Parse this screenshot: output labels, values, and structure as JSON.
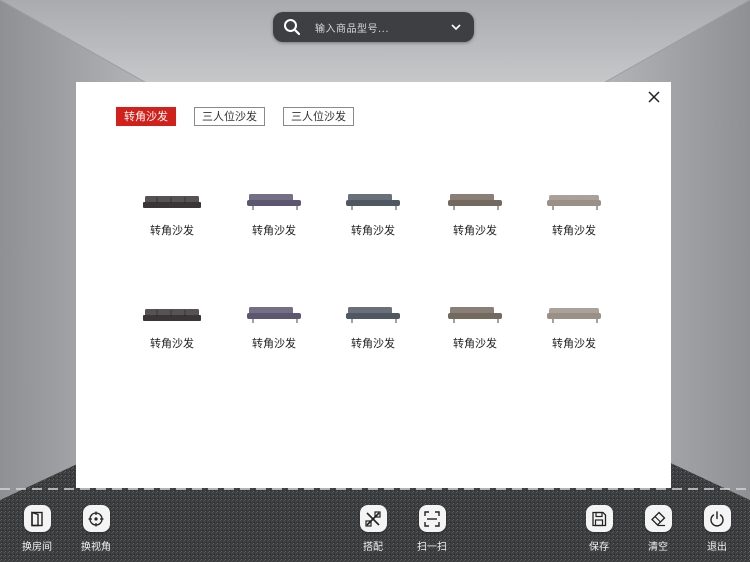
{
  "search": {
    "placeholder": "输入商品型号..."
  },
  "modal": {
    "tabs": [
      {
        "label": "转角沙发",
        "active": true
      },
      {
        "label": "三人位沙发",
        "active": false
      },
      {
        "label": "三人位沙发",
        "active": false
      }
    ],
    "products": [
      {
        "label": "转角沙发",
        "color": "#3a3536"
      },
      {
        "label": "转角沙发",
        "color": "#5d5670"
      },
      {
        "label": "转角沙发",
        "color": "#4f5763"
      },
      {
        "label": "转角沙发",
        "color": "#74695f"
      },
      {
        "label": "转角沙发",
        "color": "#9a9088"
      },
      {
        "label": "转角沙发",
        "color": "#3a3536"
      },
      {
        "label": "转角沙发",
        "color": "#5d5670"
      },
      {
        "label": "转角沙发",
        "color": "#4f5763"
      },
      {
        "label": "转角沙发",
        "color": "#74695f"
      },
      {
        "label": "转角沙发",
        "color": "#9a9088"
      }
    ]
  },
  "toolbar": {
    "left": [
      {
        "label": "换房间",
        "icon": "door-icon"
      },
      {
        "label": "换视角",
        "icon": "crosshair-icon"
      }
    ],
    "center": [
      {
        "label": "搭配",
        "icon": "match-icon"
      },
      {
        "label": "扫一扫",
        "icon": "scan-icon"
      }
    ],
    "right": [
      {
        "label": "保存",
        "icon": "save-icon"
      },
      {
        "label": "清空",
        "icon": "eraser-icon"
      },
      {
        "label": "退出",
        "icon": "power-icon"
      }
    ]
  },
  "colors": {
    "accent": "#d2201a",
    "search_bg": "#3d3f43"
  }
}
